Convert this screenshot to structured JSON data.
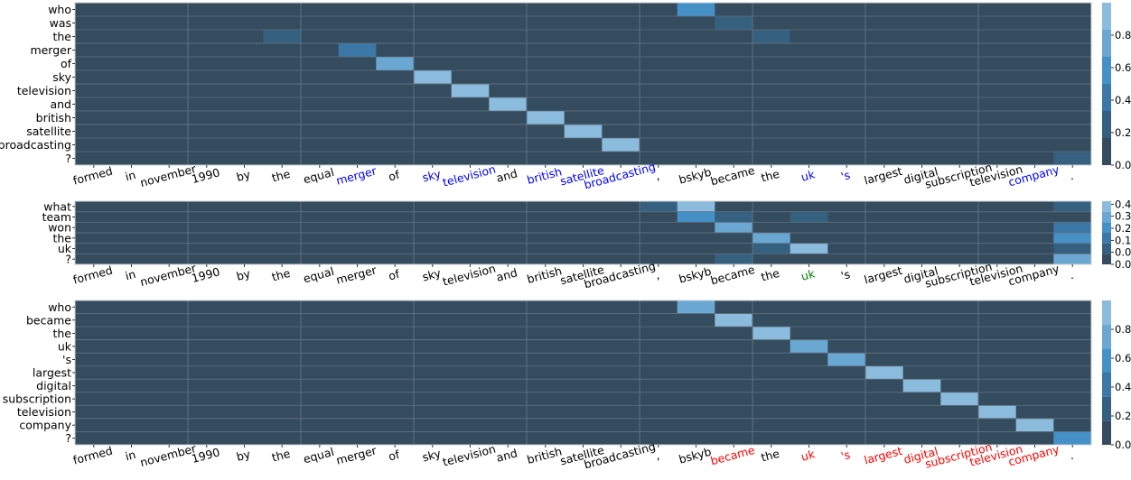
{
  "chart_data": [
    {
      "type": "heatmap",
      "title": "",
      "x_tokens": [
        "formed",
        "in",
        "november",
        "1990",
        "by",
        "the",
        "equal",
        "merger",
        "of",
        "sky",
        "television",
        "and",
        "british",
        "satellite",
        "broadcasting",
        ",",
        "bskyb",
        "became",
        "the",
        "uk",
        "'s",
        "largest",
        "digital",
        "subscription",
        "television",
        "company",
        "."
      ],
      "x_highlight": {
        "color": "#0000ff",
        "indices": [
          7,
          9,
          10,
          12,
          13,
          14,
          19,
          20,
          25
        ]
      },
      "y_tokens": [
        "who",
        "was",
        "the",
        "merger",
        "of",
        "sky",
        "television",
        "and",
        "british",
        "satellite",
        "broadcasting",
        "?"
      ],
      "colorbar": {
        "range": [
          0,
          1.0
        ],
        "ticks": [
          "0.0",
          "0.2",
          "0.4",
          "0.6",
          "0.8"
        ],
        "levels": 6
      },
      "cells": [
        {
          "row": 0,
          "col": 16,
          "value": 0.62
        },
        {
          "row": 1,
          "col": 17,
          "value": 0.25
        },
        {
          "row": 2,
          "col": 5,
          "value": 0.25
        },
        {
          "row": 2,
          "col": 18,
          "value": 0.25
        },
        {
          "row": 3,
          "col": 7,
          "value": 0.45
        },
        {
          "row": 4,
          "col": 8,
          "value": 0.78
        },
        {
          "row": 5,
          "col": 9,
          "value": 0.9
        },
        {
          "row": 6,
          "col": 10,
          "value": 0.9
        },
        {
          "row": 7,
          "col": 11,
          "value": 0.9
        },
        {
          "row": 8,
          "col": 12,
          "value": 0.9
        },
        {
          "row": 9,
          "col": 13,
          "value": 0.9
        },
        {
          "row": 10,
          "col": 14,
          "value": 0.9
        },
        {
          "row": 11,
          "col": 26,
          "value": 0.25
        }
      ]
    },
    {
      "type": "heatmap",
      "title": "",
      "x_tokens": [
        "formed",
        "in",
        "november",
        "1990",
        "by",
        "the",
        "equal",
        "merger",
        "of",
        "sky",
        "television",
        "and",
        "british",
        "satellite",
        "broadcasting",
        ",",
        "bskyb",
        "became",
        "the",
        "uk",
        "'s",
        "largest",
        "digital",
        "subscription",
        "television",
        "company",
        "."
      ],
      "x_highlight": {
        "color": "#008000",
        "indices": [
          19
        ]
      },
      "y_tokens": [
        "what",
        "team",
        "won",
        "the",
        "uk",
        "?"
      ],
      "colorbar": {
        "range": [
          0,
          0.42
        ],
        "ticks": [
          "0.00",
          "0.08",
          "0.16",
          "0.24",
          "0.32",
          "0.40"
        ],
        "levels": 6
      },
      "cells": [
        {
          "row": 0,
          "col": 15,
          "value": 0.1
        },
        {
          "row": 0,
          "col": 16,
          "value": 0.4
        },
        {
          "row": 0,
          "col": 26,
          "value": 0.1
        },
        {
          "row": 1,
          "col": 16,
          "value": 0.26
        },
        {
          "row": 1,
          "col": 17,
          "value": 0.1
        },
        {
          "row": 1,
          "col": 19,
          "value": 0.1
        },
        {
          "row": 2,
          "col": 17,
          "value": 0.33
        },
        {
          "row": 2,
          "col": 26,
          "value": 0.2
        },
        {
          "row": 3,
          "col": 18,
          "value": 0.33
        },
        {
          "row": 3,
          "col": 26,
          "value": 0.26
        },
        {
          "row": 4,
          "col": 18,
          "value": 0.1
        },
        {
          "row": 4,
          "col": 19,
          "value": 0.4
        },
        {
          "row": 4,
          "col": 26,
          "value": 0.1
        },
        {
          "row": 5,
          "col": 17,
          "value": 0.1
        },
        {
          "row": 5,
          "col": 26,
          "value": 0.33
        }
      ]
    },
    {
      "type": "heatmap",
      "title": "",
      "x_tokens": [
        "formed",
        "in",
        "november",
        "1990",
        "by",
        "the",
        "equal",
        "merger",
        "of",
        "sky",
        "television",
        "and",
        "british",
        "satellite",
        "broadcasting",
        ",",
        "bskyb",
        "became",
        "the",
        "uk",
        "'s",
        "largest",
        "digital",
        "subscription",
        "television",
        "company",
        "."
      ],
      "x_highlight": {
        "color": "#ff0000",
        "indices": [
          17,
          19,
          20,
          21,
          22,
          23,
          24,
          25
        ]
      },
      "y_tokens": [
        "who",
        "became",
        "the",
        "uk",
        "'s",
        "largest",
        "digital",
        "subscription",
        "television",
        "company",
        "?"
      ],
      "colorbar": {
        "range": [
          0,
          1.0
        ],
        "ticks": [
          "0.0",
          "0.2",
          "0.4",
          "0.6",
          "0.8"
        ],
        "levels": 6
      },
      "cells": [
        {
          "row": 0,
          "col": 16,
          "value": 0.78
        },
        {
          "row": 1,
          "col": 17,
          "value": 0.9
        },
        {
          "row": 2,
          "col": 18,
          "value": 0.9
        },
        {
          "row": 3,
          "col": 19,
          "value": 0.78
        },
        {
          "row": 4,
          "col": 20,
          "value": 0.78
        },
        {
          "row": 5,
          "col": 21,
          "value": 0.9
        },
        {
          "row": 6,
          "col": 22,
          "value": 0.9
        },
        {
          "row": 7,
          "col": 23,
          "value": 0.9
        },
        {
          "row": 8,
          "col": 24,
          "value": 0.9
        },
        {
          "row": 9,
          "col": 25,
          "value": 0.9
        },
        {
          "row": 10,
          "col": 26,
          "value": 0.62
        }
      ]
    }
  ],
  "palette": [
    "#354b5e",
    "#35607f",
    "#3b78a8",
    "#4690c8",
    "#6aa7d3",
    "#8bbbdd"
  ],
  "default_label_color": "#000000"
}
